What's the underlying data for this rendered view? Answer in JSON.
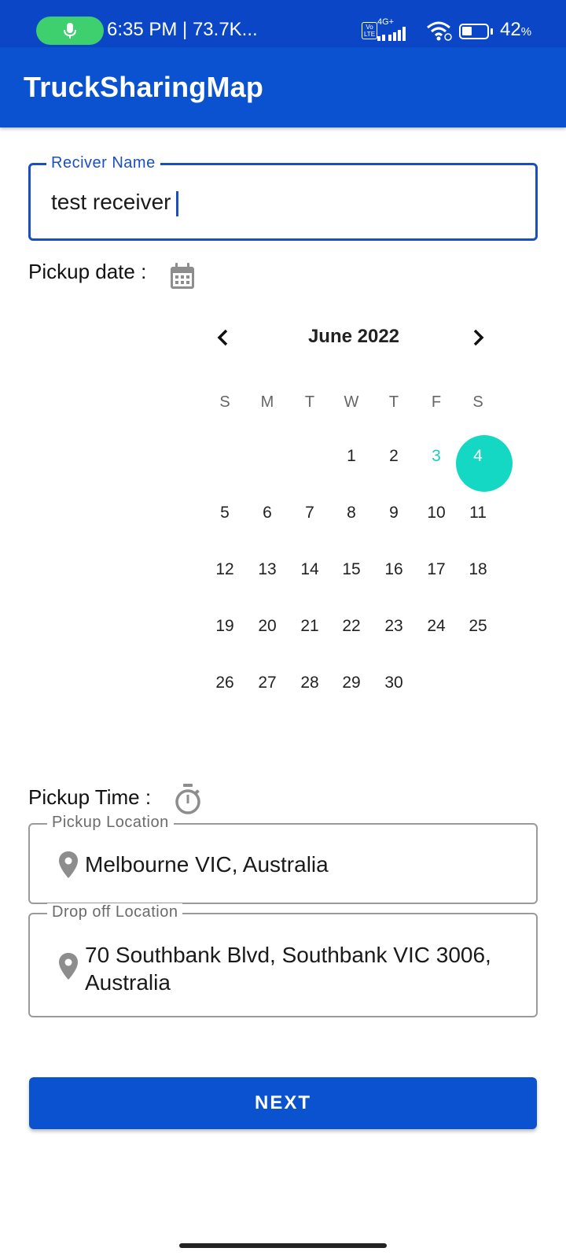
{
  "status_bar": {
    "text": "6:35 PM | 73.7K...",
    "network": "4G+",
    "volte": "Vo LTE",
    "battery": "42",
    "battery_unit": "%",
    "icons": [
      "mic-icon",
      "volte-icon",
      "signal-icon",
      "wifi-icon",
      "battery-icon"
    ]
  },
  "app_bar": {
    "title": "TruckSharingMap"
  },
  "receiver_field": {
    "label": "Reciver Name",
    "value": "test receiver"
  },
  "pickup_date": {
    "label": "Pickup date :",
    "icon": "calendar-icon"
  },
  "calendar": {
    "month_label": "June 2022",
    "weekdays": [
      "S",
      "M",
      "T",
      "W",
      "T",
      "F",
      "S"
    ],
    "today": 3,
    "selected": 4,
    "days": [
      "1",
      "2",
      "3",
      "4",
      "5",
      "6",
      "7",
      "8",
      "9",
      "10",
      "11",
      "12",
      "13",
      "14",
      "15",
      "16",
      "17",
      "18",
      "19",
      "20",
      "21",
      "22",
      "23",
      "24",
      "25",
      "26",
      "27",
      "28",
      "29",
      "30"
    ],
    "colors": {
      "selected": "#15d8c4",
      "today_text": "#1ccfc0"
    }
  },
  "pickup_time": {
    "label": "Pickup Time :",
    "icon": "timer-icon"
  },
  "pickup_location": {
    "label": "Pickup Location",
    "value": "Melbourne VIC, Australia",
    "icon": "location-pin-icon"
  },
  "dropoff_location": {
    "label": "Drop off Location",
    "line1": "70 Southbank Blvd, Southbank VIC 3006,",
    "line2": "Australia",
    "icon": "location-pin-icon"
  },
  "next_button": {
    "label": "NEXT"
  },
  "colors": {
    "primary": "#0b52d0",
    "status_bar": "#0b46c7",
    "accent": "#1a4fc4"
  }
}
